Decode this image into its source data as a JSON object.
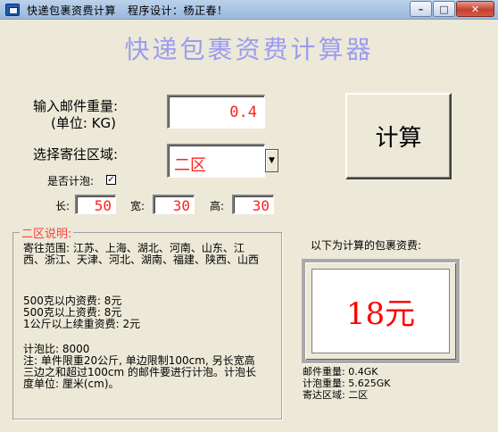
{
  "window": {
    "title": "快递包裹资费计算   程序设计：杨正春！",
    "min_label": "–",
    "max_label": "□",
    "close_label": "✕"
  },
  "app_title": "快递包裹资费计算器",
  "weight": {
    "label_line1": "输入邮件重量:",
    "label_line2": "(单位: KG)",
    "value": "0.4"
  },
  "region": {
    "label": "选择寄往区域:",
    "selected": "二区"
  },
  "calc_button_label": "计算",
  "bubble": {
    "label": "是否计泡:",
    "checked_mark": "✓"
  },
  "dimensions": {
    "length_label": "长:",
    "length": "50",
    "width_label": "宽:",
    "width": "30",
    "height_label": "高:",
    "height": "30"
  },
  "region_info": {
    "legend": "二区说明:",
    "scope": "寄往范围: 江苏、上海、湖北、河南、山东、江西、浙江、天津、河北、湖南、福建、陕西、山西",
    "fee_within_500": "500克以内资费: 8元",
    "fee_over_500": "500克以上资费: 8元",
    "fee_over_1kg": "1公斤以上续重资费: 2元",
    "bubble_ratio": "计泡比: 8000",
    "note": "注: 单件限重20公斤, 单边限制100cm, 另长宽高三边之和超过100cm 的邮件要进行计泡。计泡长度单位: 厘米(cm)。"
  },
  "result": {
    "caption": "以下为计算的包裹资费:",
    "amount": "18元",
    "mail_weight": "邮件重量: 0.4GK",
    "bubble_weight": "计泡重量: 5.625GK",
    "send_region": "寄达区域: 二区"
  }
}
